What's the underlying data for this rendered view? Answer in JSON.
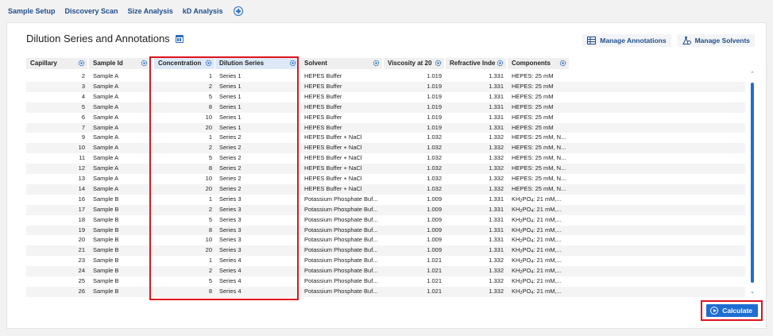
{
  "tabs": [
    {
      "label": "Sample Setup"
    },
    {
      "label": "Discovery Scan"
    },
    {
      "label": "Size Analysis"
    },
    {
      "label": "kD Analysis"
    }
  ],
  "page_title": "Dilution Series and Annotations",
  "buttons": {
    "manage_annotations": "Manage Annotations",
    "manage_solvents": "Manage Solvents",
    "calculate": "Calculate"
  },
  "columns": [
    {
      "label": "Capillary"
    },
    {
      "label": "Sample Id"
    },
    {
      "label": "Concentration"
    },
    {
      "label": "Dilution Series"
    },
    {
      "label": "Solvent"
    },
    {
      "label": "Viscosity at 20"
    },
    {
      "label": "Refractive Inde"
    },
    {
      "label": "Components"
    }
  ],
  "rows": [
    {
      "capillary": "2",
      "sample_id": "Sample A",
      "concentration": "1",
      "series": "Series 1",
      "solvent": "HEPES Buffer",
      "viscosity": "1.019",
      "refractive": "1.331",
      "comp_pre": "HEPES: 25 mM",
      "comp_sub1": "",
      "comp_mid": "",
      "comp_sub2": "",
      "comp_post": ""
    },
    {
      "capillary": "3",
      "sample_id": "Sample A",
      "concentration": "2",
      "series": "Series 1",
      "solvent": "HEPES Buffer",
      "viscosity": "1.019",
      "refractive": "1.331",
      "comp_pre": "HEPES: 25 mM",
      "comp_sub1": "",
      "comp_mid": "",
      "comp_sub2": "",
      "comp_post": ""
    },
    {
      "capillary": "4",
      "sample_id": "Sample A",
      "concentration": "5",
      "series": "Series 1",
      "solvent": "HEPES Buffer",
      "viscosity": "1.019",
      "refractive": "1.331",
      "comp_pre": "HEPES: 25 mM",
      "comp_sub1": "",
      "comp_mid": "",
      "comp_sub2": "",
      "comp_post": ""
    },
    {
      "capillary": "5",
      "sample_id": "Sample A",
      "concentration": "8",
      "series": "Series 1",
      "solvent": "HEPES Buffer",
      "viscosity": "1.019",
      "refractive": "1.331",
      "comp_pre": "HEPES: 25 mM",
      "comp_sub1": "",
      "comp_mid": "",
      "comp_sub2": "",
      "comp_post": ""
    },
    {
      "capillary": "6",
      "sample_id": "Sample A",
      "concentration": "10",
      "series": "Series 1",
      "solvent": "HEPES Buffer",
      "viscosity": "1.019",
      "refractive": "1.331",
      "comp_pre": "HEPES: 25 mM",
      "comp_sub1": "",
      "comp_mid": "",
      "comp_sub2": "",
      "comp_post": ""
    },
    {
      "capillary": "7",
      "sample_id": "Sample A",
      "concentration": "20",
      "series": "Series 1",
      "solvent": "HEPES Buffer",
      "viscosity": "1.019",
      "refractive": "1.331",
      "comp_pre": "HEPES: 25 mM",
      "comp_sub1": "",
      "comp_mid": "",
      "comp_sub2": "",
      "comp_post": ""
    },
    {
      "capillary": "9",
      "sample_id": "Sample A",
      "concentration": "1",
      "series": "Series 2",
      "solvent": "HEPES Buffer + NaCl",
      "viscosity": "1.032",
      "refractive": "1.332",
      "comp_pre": "HEPES: 25 mM, N...",
      "comp_sub1": "",
      "comp_mid": "",
      "comp_sub2": "",
      "comp_post": ""
    },
    {
      "capillary": "10",
      "sample_id": "Sample A",
      "concentration": "2",
      "series": "Series 2",
      "solvent": "HEPES Buffer + NaCl",
      "viscosity": "1.032",
      "refractive": "1.332",
      "comp_pre": "HEPES: 25 mM, N...",
      "comp_sub1": "",
      "comp_mid": "",
      "comp_sub2": "",
      "comp_post": ""
    },
    {
      "capillary": "11",
      "sample_id": "Sample A",
      "concentration": "5",
      "series": "Series 2",
      "solvent": "HEPES Buffer + NaCl",
      "viscosity": "1.032",
      "refractive": "1.332",
      "comp_pre": "HEPES: 25 mM, N...",
      "comp_sub1": "",
      "comp_mid": "",
      "comp_sub2": "",
      "comp_post": ""
    },
    {
      "capillary": "12",
      "sample_id": "Sample A",
      "concentration": "8",
      "series": "Series 2",
      "solvent": "HEPES Buffer + NaCl",
      "viscosity": "1.032",
      "refractive": "1.332",
      "comp_pre": "HEPES: 25 mM, N...",
      "comp_sub1": "",
      "comp_mid": "",
      "comp_sub2": "",
      "comp_post": ""
    },
    {
      "capillary": "13",
      "sample_id": "Sample A",
      "concentration": "10",
      "series": "Series 2",
      "solvent": "HEPES Buffer + NaCl",
      "viscosity": "1.032",
      "refractive": "1.332",
      "comp_pre": "HEPES: 25 mM, N...",
      "comp_sub1": "",
      "comp_mid": "",
      "comp_sub2": "",
      "comp_post": ""
    },
    {
      "capillary": "14",
      "sample_id": "Sample A",
      "concentration": "20",
      "series": "Series 2",
      "solvent": "HEPES Buffer + NaCl",
      "viscosity": "1.032",
      "refractive": "1.332",
      "comp_pre": "HEPES: 25 mM, N...",
      "comp_sub1": "",
      "comp_mid": "",
      "comp_sub2": "",
      "comp_post": ""
    },
    {
      "capillary": "16",
      "sample_id": "Sample B",
      "concentration": "1",
      "series": "Series 3",
      "solvent": "Potassium Phosphate Buf...",
      "viscosity": "1.009",
      "refractive": "1.331",
      "comp_pre": "KH",
      "comp_sub1": "2",
      "comp_mid": "PO",
      "comp_sub2": "4",
      "comp_post": ": 21 mM,..."
    },
    {
      "capillary": "17",
      "sample_id": "Sample B",
      "concentration": "2",
      "series": "Series 3",
      "solvent": "Potassium Phosphate Buf...",
      "viscosity": "1.009",
      "refractive": "1.331",
      "comp_pre": "KH",
      "comp_sub1": "2",
      "comp_mid": "PO",
      "comp_sub2": "4",
      "comp_post": ": 21 mM,..."
    },
    {
      "capillary": "18",
      "sample_id": "Sample B",
      "concentration": "5",
      "series": "Series 3",
      "solvent": "Potassium Phosphate Buf...",
      "viscosity": "1.009",
      "refractive": "1.331",
      "comp_pre": "KH",
      "comp_sub1": "2",
      "comp_mid": "PO",
      "comp_sub2": "4",
      "comp_post": ": 21 mM,..."
    },
    {
      "capillary": "19",
      "sample_id": "Sample B",
      "concentration": "8",
      "series": "Series 3",
      "solvent": "Potassium Phosphate Buf...",
      "viscosity": "1.009",
      "refractive": "1.331",
      "comp_pre": "KH",
      "comp_sub1": "2",
      "comp_mid": "PO",
      "comp_sub2": "4",
      "comp_post": ": 21 mM,..."
    },
    {
      "capillary": "20",
      "sample_id": "Sample B",
      "concentration": "10",
      "series": "Series 3",
      "solvent": "Potassium Phosphate Buf...",
      "viscosity": "1.009",
      "refractive": "1.331",
      "comp_pre": "KH",
      "comp_sub1": "2",
      "comp_mid": "PO",
      "comp_sub2": "4",
      "comp_post": ": 21 mM,..."
    },
    {
      "capillary": "21",
      "sample_id": "Sample B",
      "concentration": "20",
      "series": "Series 3",
      "solvent": "Potassium Phosphate Buf...",
      "viscosity": "1.009",
      "refractive": "1.331",
      "comp_pre": "KH",
      "comp_sub1": "2",
      "comp_mid": "PO",
      "comp_sub2": "4",
      "comp_post": ": 21 mM,..."
    },
    {
      "capillary": "23",
      "sample_id": "Sample B",
      "concentration": "1",
      "series": "Series 4",
      "solvent": "Potassium Phosphate Buf...",
      "viscosity": "1.021",
      "refractive": "1.332",
      "comp_pre": "KH",
      "comp_sub1": "2",
      "comp_mid": "PO",
      "comp_sub2": "4",
      "comp_post": ": 21 mM,..."
    },
    {
      "capillary": "24",
      "sample_id": "Sample B",
      "concentration": "2",
      "series": "Series 4",
      "solvent": "Potassium Phosphate Buf...",
      "viscosity": "1.021",
      "refractive": "1.332",
      "comp_pre": "KH",
      "comp_sub1": "2",
      "comp_mid": "PO",
      "comp_sub2": "4",
      "comp_post": ": 21 mM,..."
    },
    {
      "capillary": "25",
      "sample_id": "Sample B",
      "concentration": "5",
      "series": "Series 4",
      "solvent": "Potassium Phosphate Buf...",
      "viscosity": "1.021",
      "refractive": "1.332",
      "comp_pre": "KH",
      "comp_sub1": "2",
      "comp_mid": "PO",
      "comp_sub2": "4",
      "comp_post": ": 21 mM,..."
    },
    {
      "capillary": "26",
      "sample_id": "Sample B",
      "concentration": "8",
      "series": "Series 4",
      "solvent": "Potassium Phosphate Buf...",
      "viscosity": "1.021",
      "refractive": "1.332",
      "comp_pre": "KH",
      "comp_sub1": "2",
      "comp_mid": "PO",
      "comp_sub2": "4",
      "comp_post": ": 21 mM,..."
    }
  ],
  "colors": {
    "accent": "#1f6ed4",
    "tab_text": "#1f4e8c",
    "highlight": "#e0141f",
    "header_bg": "#efefef",
    "selected_header_bg": "#dde9f7"
  }
}
